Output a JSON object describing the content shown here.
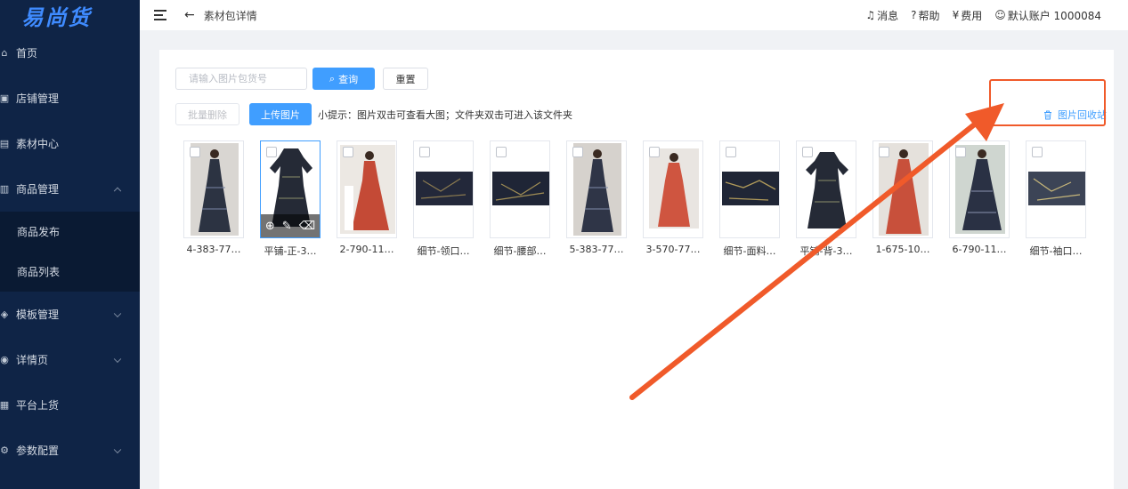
{
  "app": {
    "logo": "易尚货"
  },
  "sidebar": {
    "items": [
      {
        "label": "首页",
        "icon": "⌂"
      },
      {
        "label": "店铺管理",
        "icon": "▣"
      },
      {
        "label": "素材中心",
        "icon": "▤"
      },
      {
        "label": "商品管理",
        "icon": "▥"
      },
      {
        "label": "模板管理",
        "icon": "◈"
      },
      {
        "label": "详情页",
        "icon": "◉"
      },
      {
        "label": "平台上货",
        "icon": "▦"
      },
      {
        "label": "参数配置",
        "icon": "⚙"
      }
    ],
    "submenu": [
      {
        "label": "商品发布"
      },
      {
        "label": "商品列表"
      }
    ]
  },
  "topbar": {
    "title": "素材包详情",
    "messages": "消息",
    "help": "帮助",
    "fees": "费用",
    "account": "默认账户 1000084"
  },
  "search": {
    "placeholder": "请输入图片包货号",
    "value": ""
  },
  "buttons": {
    "query": "查询",
    "reset": "重置",
    "batch_delete": "批量删除",
    "upload": "上传图片",
    "recycle_bin": "图片回收站"
  },
  "tip": "小提示：图片双击可查看大图；文件夹双击可进入该文件夹",
  "images": [
    {
      "name": "4-383-77…",
      "kind": "dress-dark"
    },
    {
      "name": "平铺-正-3…",
      "kind": "flat-dark"
    },
    {
      "name": "2-790-11…",
      "kind": "dress-red"
    },
    {
      "name": "细节-领口…",
      "kind": "fabric"
    },
    {
      "name": "细节-腰部…",
      "kind": "fabric"
    },
    {
      "name": "5-383-77…",
      "kind": "dress-dark"
    },
    {
      "name": "3-570-77…",
      "kind": "dress-red"
    },
    {
      "name": "细节-面料…",
      "kind": "fabric"
    },
    {
      "name": "平铺-背-3…",
      "kind": "flat-dark"
    },
    {
      "name": "1-675-10…",
      "kind": "dress-red"
    },
    {
      "name": "6-790-11…",
      "kind": "dress-dark"
    },
    {
      "name": "细节-袖口…",
      "kind": "fabric"
    }
  ],
  "colors": {
    "sidebar": "#0f2446",
    "accent": "#409eff",
    "annotation": "#f05a2a"
  }
}
